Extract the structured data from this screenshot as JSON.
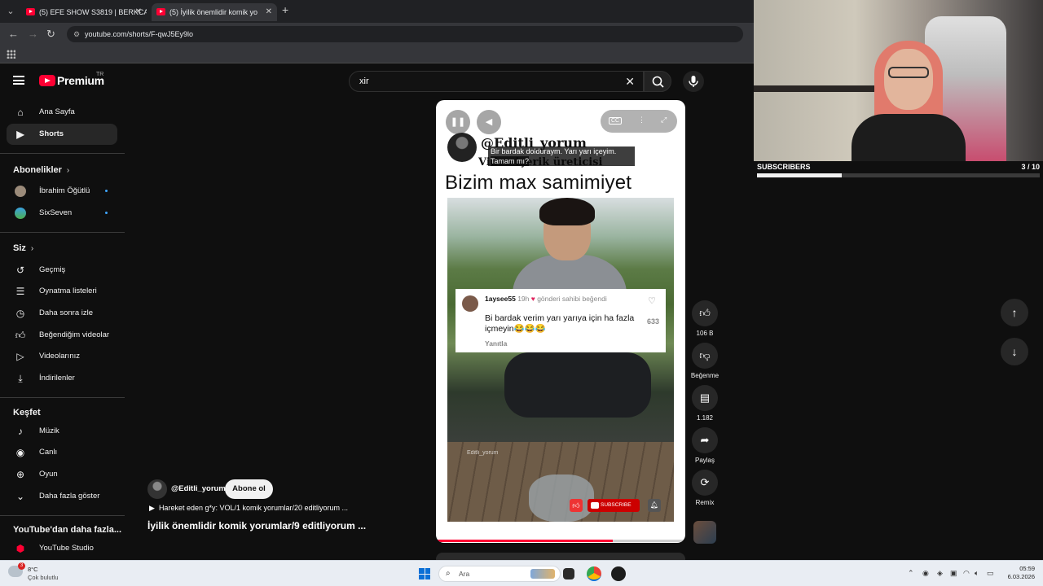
{
  "browser": {
    "tabs": [
      {
        "title": "(5) EFE SHOW S3819 | BERKCAN",
        "close": "✕"
      },
      {
        "title": "(5) İyilik önemlidir komik yo",
        "close": "✕"
      }
    ],
    "new_tab": "+",
    "url": "youtube.com/shorts/F-qwJ5Ey9lo"
  },
  "header": {
    "logo_text": "Premium",
    "country_code": "TR",
    "search_value": "xir",
    "clear_glyph": "✕"
  },
  "sidebar": {
    "primary": [
      {
        "label": "Ana Sayfa",
        "icon": "home-icon"
      },
      {
        "label": "Shorts",
        "icon": "shorts-icon",
        "active": true
      }
    ],
    "subscriptions_title": "Abonelikler",
    "subscriptions": [
      {
        "label": "İbrahim Öğütlü"
      },
      {
        "label": "SixSeven"
      }
    ],
    "you_title": "Siz",
    "you": [
      {
        "label": "Geçmiş",
        "icon": "history-icon"
      },
      {
        "label": "Oynatma listeleri",
        "icon": "playlists-icon"
      },
      {
        "label": "Daha sonra izle",
        "icon": "watch-later-icon"
      },
      {
        "label": "Beğendiğim videolar",
        "icon": "liked-videos-icon"
      },
      {
        "label": "Videolarınız",
        "icon": "your-videos-icon"
      },
      {
        "label": "İndirilenler",
        "icon": "downloads-icon"
      }
    ],
    "explore_title": "Keşfet",
    "explore": [
      {
        "label": "Müzik",
        "icon": "music-icon"
      },
      {
        "label": "Canlı",
        "icon": "live-icon"
      },
      {
        "label": "Oyun",
        "icon": "gaming-icon"
      },
      {
        "label": "Daha fazla göster",
        "icon": "chevron-down-icon"
      }
    ],
    "more_title": "YouTube'dan daha fazla...",
    "more": [
      {
        "label": "YouTube Studio",
        "icon": "youtube-studio-icon"
      }
    ]
  },
  "short": {
    "overlay_handle": "@Editli_yorum",
    "overlay_subtitle": "Video içerik üreticisi",
    "caption_line1": "Bir bardak dolduraym. Yarı yarı içeyim.",
    "caption_line2": "Tamam mı?",
    "video_title": "Bizim max samimiyet",
    "comment": {
      "user": "1aysee55",
      "time": "19h",
      "liked_by": "gönderi sahibi beğendi",
      "text": "Bi bardak verim yarı yarıya için ha fazla içmeyin😂😂😂",
      "reply": "Yanıtla",
      "likes": "633"
    },
    "watermark": "Editli_yorum",
    "subscribe_overlay": "SUBSCRIBE",
    "progress": 0.71
  },
  "channel": {
    "handle": "@Editli_yorum",
    "subscribe_label": "Abone ol",
    "music": "Hareket eden g*y: VOL/1 komik yorumlar/20 editliyorum ...",
    "title": "İyilik önemlidir komik yorumlar/9 editliyorum ..."
  },
  "actions": {
    "like": "106 B",
    "dislike": "Beğenme",
    "comments": "1.182",
    "share": "Paylaş",
    "remix": "Remix"
  },
  "stream_widget": {
    "label": "SUBSCRIBERS",
    "count": "3 / 10",
    "progress": 0.3
  },
  "taskbar": {
    "weather_temp": "8°C",
    "weather_desc": "Çok bulutlu",
    "weather_badge": "3",
    "search_placeholder": "Ara",
    "time": "05:59",
    "date": "6.03.2026"
  },
  "colors": {
    "youtube_red": "#ff0033",
    "background": "#0f0f0f",
    "taskbar": "#e9edf3"
  }
}
